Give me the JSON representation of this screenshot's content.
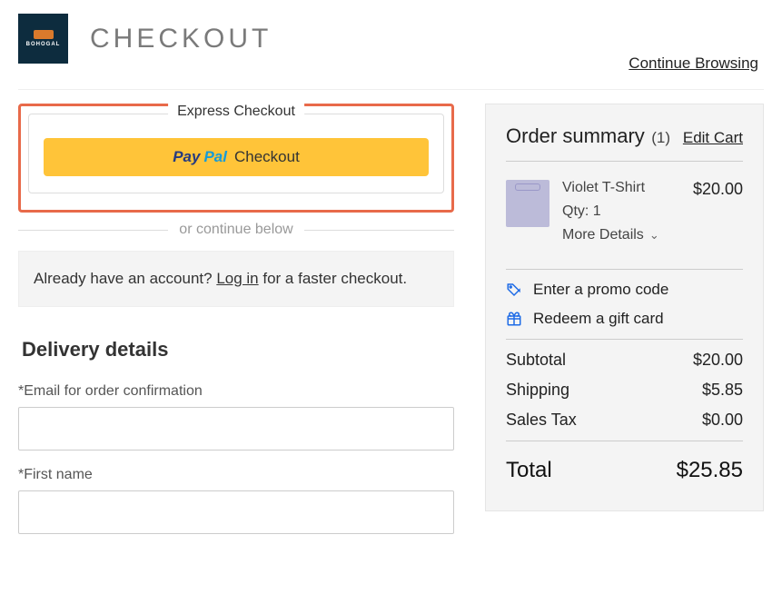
{
  "header": {
    "brand": "BOHOGAL",
    "title": "CHECKOUT",
    "continue_link": "Continue Browsing"
  },
  "express": {
    "label": "Express Checkout",
    "paypal_pay": "Pay",
    "paypal_pal": "Pal",
    "paypal_checkout": "Checkout"
  },
  "or_divider": "or continue below",
  "login": {
    "pre": "Already have an account? ",
    "link": "Log in",
    "post": " for a faster checkout."
  },
  "delivery": {
    "title": "Delivery details",
    "email_label": "*Email for order confirmation",
    "firstname_label": "*First name"
  },
  "summary": {
    "title": "Order summary",
    "count": "(1)",
    "edit": "Edit Cart",
    "item": {
      "name": "Violet T-Shirt",
      "qty": "Qty: 1",
      "details": "More Details",
      "price": "$20.00"
    },
    "promo": "Enter a promo code",
    "gift": "Redeem a gift card",
    "subtotal_label": "Subtotal",
    "subtotal_value": "$20.00",
    "shipping_label": "Shipping",
    "shipping_value": "$5.85",
    "tax_label": "Sales Tax",
    "tax_value": "$0.00",
    "total_label": "Total",
    "total_value": "$25.85"
  }
}
